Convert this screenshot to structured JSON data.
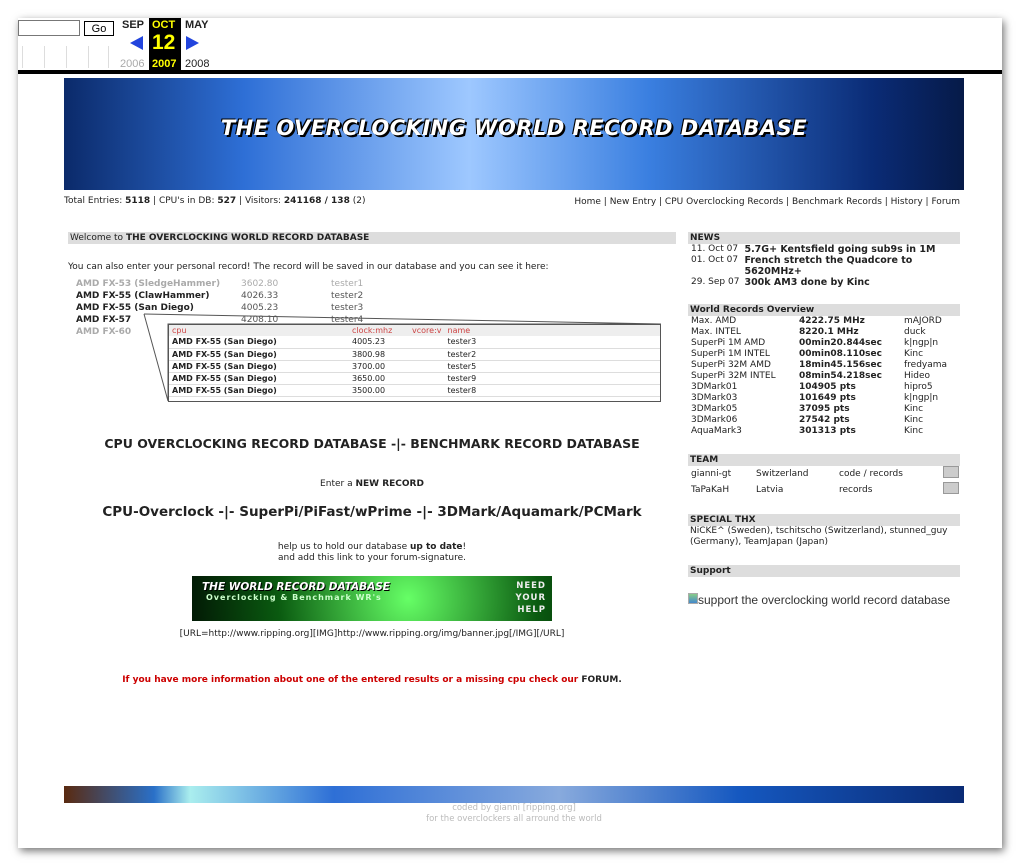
{
  "wayback": {
    "go": "Go",
    "prev_month": "SEP",
    "cur_month": "OCT",
    "next_month": "MAY",
    "day": "12",
    "prev_year": "2006",
    "cur_year": "2007",
    "next_year": "2008"
  },
  "banner_title": "THE OVERCLOCKING WORLD RECORD DATABASE",
  "stats": {
    "entries_label": "Total Entries:",
    "entries": "5118",
    "cpus_label": "CPU's in DB:",
    "cpus": "527",
    "visitors_label": "Visitors:",
    "visitors": "241168 / 138",
    "online": "(2)"
  },
  "nav": [
    "Home",
    "New Entry",
    "CPU Overclocking Records",
    "Benchmark Records",
    "History",
    "Forum"
  ],
  "welcome": {
    "prefix": "Welcome to",
    "title": "THE OVERCLOCKING WORLD RECORD DATABASE"
  },
  "intro": "You can also enter your personal record! The record will be saved in our database and you can see it here:",
  "demo_rows": [
    [
      "AMD FX-53 (SledgeHammer)",
      "3602.80",
      "tester1"
    ],
    [
      "AMD FX-55 (ClawHammer)",
      "4026.33",
      "tester2"
    ],
    [
      "AMD FX-55 (San Diego)",
      "4005.23",
      "tester3"
    ],
    [
      "AMD FX-57",
      "4208.10",
      "tester4"
    ],
    [
      "AMD FX-60",
      "",
      ""
    ]
  ],
  "popup": {
    "headers": [
      "cpu",
      "clock:mhz",
      "vcore:v",
      "name"
    ],
    "rows": [
      [
        "AMD FX-55 (San Diego)",
        "4005.23",
        "",
        "tester3"
      ],
      [
        "AMD FX-55 (San Diego)",
        "3800.98",
        "",
        "tester2"
      ],
      [
        "AMD FX-55 (San Diego)",
        "3700.00",
        "",
        "tester5"
      ],
      [
        "AMD FX-55 (San Diego)",
        "3650.00",
        "",
        "tester9"
      ],
      [
        "AMD FX-55 (San Diego)",
        "3500.00",
        "",
        "tester8"
      ]
    ]
  },
  "db_links": {
    "cpu": "CPU OVERCLOCKING RECORD DATABASE",
    "sep": "-|-",
    "bench": "BENCHMARK RECORD DATABASE"
  },
  "enter": {
    "prefix": "Enter a",
    "label": "NEW RECORD"
  },
  "new_links": {
    "a": "CPU-Overclock",
    "b": "SuperPi/PiFast/wPrime",
    "c": "3DMark/Aquamark/PCMark",
    "sep": "-|-"
  },
  "help": {
    "l1a": "help us to hold our database",
    "l1b": "up to date",
    "l1c": "!",
    "l2": "and add this link to your forum-signature."
  },
  "sig_banner": {
    "title": "THE WORLD RECORD DATABASE",
    "sub": "Overclocking & Benchmark WR's",
    "need": "NEED",
    "your": "YOUR",
    "help": "HELP"
  },
  "sig_code": "[URL=http://www.ripping.org][IMG]http://www.ripping.org/img/banner.jpg[/IMG][/URL]",
  "info": {
    "text": "If you have more information about one of the entered results or a missing cpu check our",
    "link": "FORUM",
    "end": "."
  },
  "news": {
    "title": "NEWS",
    "items": [
      [
        "11. Oct 07",
        "5.7G+ Kentsfield going sub9s in 1M"
      ],
      [
        "01. Oct 07",
        "French stretch the Quadcore to 5620MHz+"
      ],
      [
        "29. Sep 07",
        "300k AM3 done by Kinc"
      ]
    ]
  },
  "records": {
    "title": "World Records Overview",
    "rows": [
      [
        "Max. AMD",
        "4222.75 MHz",
        "mAJORD"
      ],
      [
        "Max. INTEL",
        "8220.1 MHz",
        "duck"
      ],
      [
        "SuperPi 1M AMD",
        "00min20.844sec",
        "k|ngp|n"
      ],
      [
        "SuperPi 1M INTEL",
        "00min08.110sec",
        "Kinc"
      ],
      [
        "SuperPi 32M AMD",
        "18min45.156sec",
        "fredyama"
      ],
      [
        "SuperPi 32M INTEL",
        "08min54.218sec",
        "Hideo"
      ],
      [
        "3DMark01",
        "104905 pts",
        "hipro5"
      ],
      [
        "3DMark03",
        "101649 pts",
        "k|ngp|n"
      ],
      [
        "3DMark05",
        "37095 pts",
        "Kinc"
      ],
      [
        "3DMark06",
        "27542 pts",
        "Kinc"
      ],
      [
        "AquaMark3",
        "301313 pts",
        "Kinc"
      ]
    ]
  },
  "team": {
    "title": "TEAM",
    "rows": [
      [
        "gianni-gt",
        "Switzerland",
        "code / records"
      ],
      [
        "TaPaKaH",
        "Latvia",
        "records"
      ]
    ]
  },
  "thx": {
    "title": "SPECIAL THX",
    "text": "NiCKE^ (Sweden), tschitscho (Switzerland), stunned_guy (Germany), TeamJapan (Japan)"
  },
  "support": {
    "title": "Support",
    "alt": "support the overclocking world record database"
  },
  "footer": {
    "l1": "coded by gianni [ripping.org]",
    "l2": "for the overclockers all arround the world"
  }
}
